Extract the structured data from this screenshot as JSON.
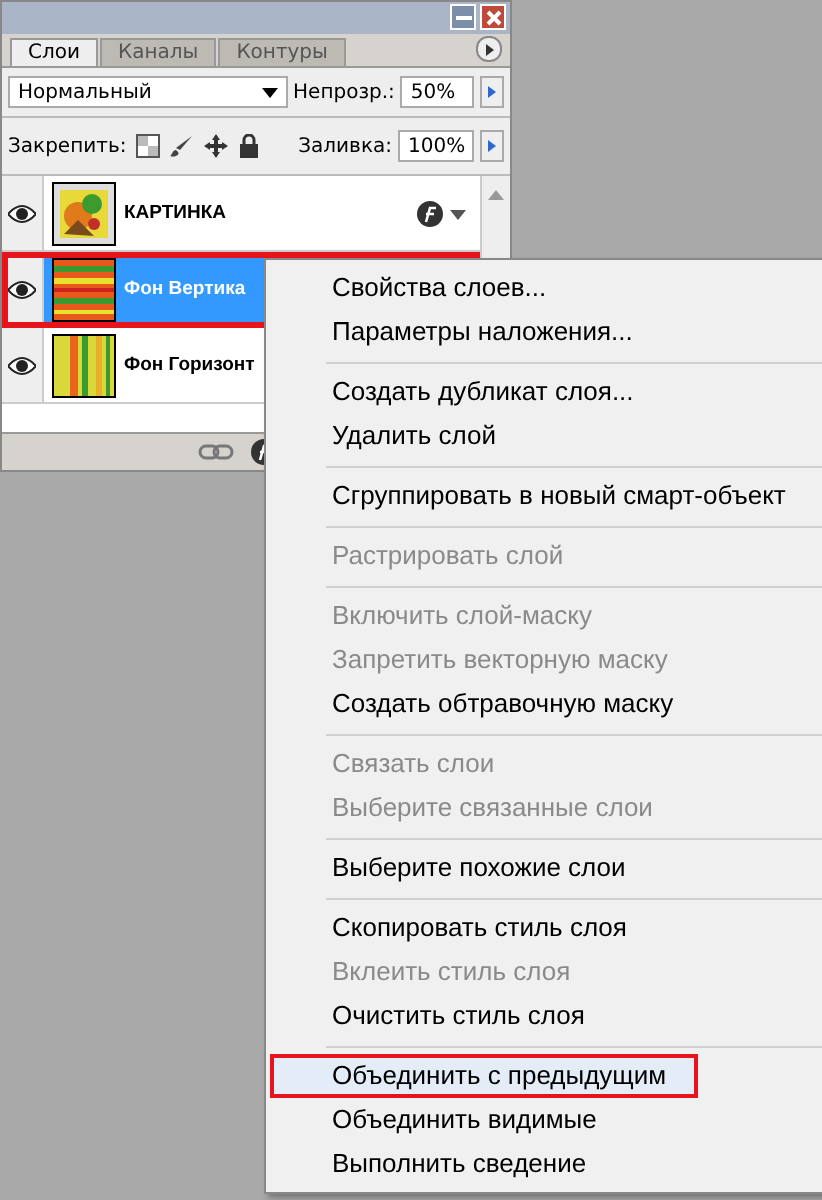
{
  "tabs": [
    {
      "label": "Слои",
      "selected": true
    },
    {
      "label": "Каналы",
      "selected": false
    },
    {
      "label": "Контуры",
      "selected": false
    }
  ],
  "blend": {
    "mode": "Нормальный",
    "opacity_label": "Непрозр.:",
    "opacity": "50%"
  },
  "lock": {
    "label": "Закрепить:",
    "fill_label": "Заливка:",
    "fill": "100%"
  },
  "layers": [
    {
      "name": "КАРТИНКА",
      "visible": true,
      "selected": false,
      "kind": "picture",
      "effects": true
    },
    {
      "name": "Фон Вертика",
      "visible": true,
      "selected": true,
      "kind": "hstripes"
    },
    {
      "name": "Фон Горизонт",
      "visible": true,
      "selected": false,
      "kind": "vstripes"
    }
  ],
  "menu": [
    [
      {
        "label": "Свойства слоев...",
        "disabled": false,
        "highlighted": false
      },
      {
        "label": "Параметры наложения...",
        "disabled": false,
        "highlighted": false
      }
    ],
    [
      {
        "label": "Создать дубликат слоя...",
        "disabled": false,
        "highlighted": false
      },
      {
        "label": "Удалить слой",
        "disabled": false,
        "highlighted": false
      }
    ],
    [
      {
        "label": "Сгруппировать в новый смарт-объект",
        "disabled": false,
        "highlighted": false
      }
    ],
    [
      {
        "label": "Растрировать слой",
        "disabled": true,
        "highlighted": false
      }
    ],
    [
      {
        "label": "Включить слой-маску",
        "disabled": true,
        "highlighted": false
      },
      {
        "label": "Запретить векторную маску",
        "disabled": true,
        "highlighted": false
      },
      {
        "label": "Создать обтравочную маску",
        "disabled": false,
        "highlighted": false
      }
    ],
    [
      {
        "label": "Связать слои",
        "disabled": true,
        "highlighted": false
      },
      {
        "label": "Выберите связанные слои",
        "disabled": true,
        "highlighted": false
      }
    ],
    [
      {
        "label": "Выберите похожие слои",
        "disabled": false,
        "highlighted": false
      }
    ],
    [
      {
        "label": "Скопировать стиль слоя",
        "disabled": false,
        "highlighted": false
      },
      {
        "label": "Вклеить стиль слоя",
        "disabled": true,
        "highlighted": false
      },
      {
        "label": "Очистить стиль слоя",
        "disabled": false,
        "highlighted": false
      }
    ],
    [
      {
        "label": "Объединить с предыдущим",
        "disabled": false,
        "highlighted": true
      },
      {
        "label": "Объединить видимые",
        "disabled": false,
        "highlighted": false
      },
      {
        "label": "Выполнить сведение",
        "disabled": false,
        "highlighted": false
      }
    ]
  ]
}
